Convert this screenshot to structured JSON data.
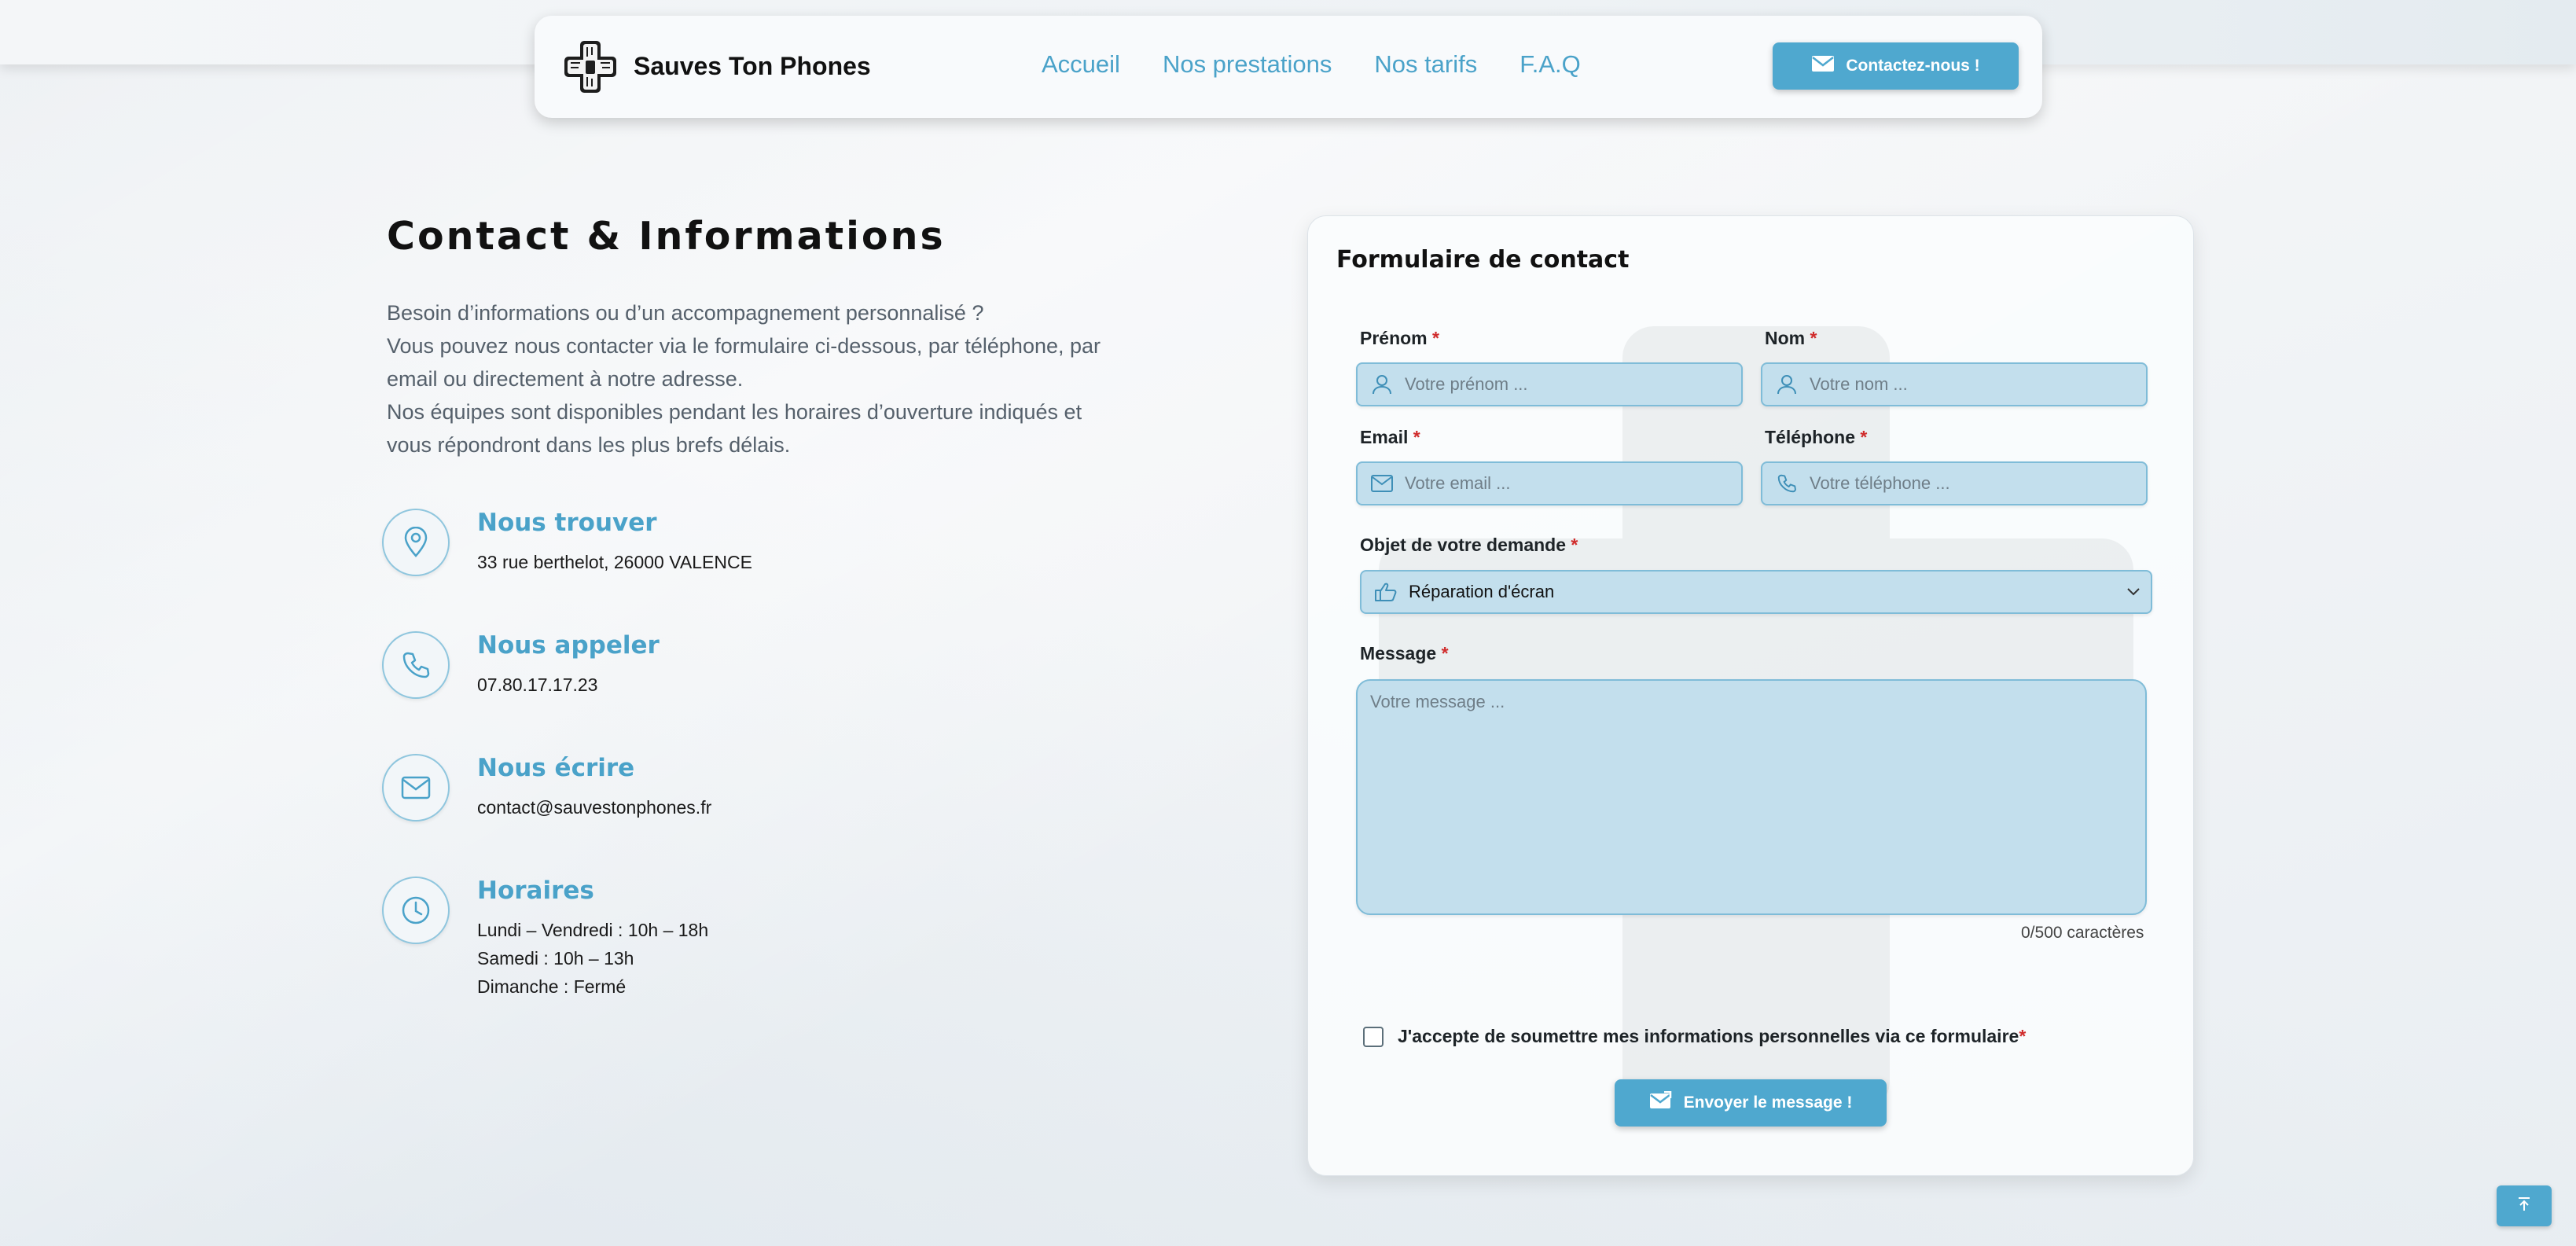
{
  "header": {
    "brand_name": "Sauves Ton Phones",
    "nav": [
      "Accueil",
      "Nos prestations",
      "Nos tarifs",
      "F.A.Q"
    ],
    "contact_button": "Contactez-nous !"
  },
  "page": {
    "title": "Contact & Informations",
    "intro": [
      "Besoin d’informations ou d’un accompagnement personnalisé ?",
      "Vous pouvez nous contacter via le formulaire ci-dessous, par téléphone, par email ou directement à notre adresse.",
      "Nos équipes sont disponibles pendant les horaires d’ouverture indiqués et vous répondront dans les plus brefs délais."
    ]
  },
  "info": [
    {
      "icon": "map-pin-icon",
      "title": "Nous trouver",
      "lines": [
        "33 rue berthelot, 26000 VALENCE"
      ]
    },
    {
      "icon": "phone-icon",
      "title": "Nous appeler",
      "lines": [
        "07.80.17.17.23"
      ]
    },
    {
      "icon": "mail-icon",
      "title": "Nous écrire",
      "lines": [
        "contact@sauvestonphones.fr"
      ]
    },
    {
      "icon": "clock-icon",
      "title": "Horaires",
      "lines": [
        "Lundi – Vendredi : 10h – 18h",
        "Samedi : 10h – 13h",
        "Dimanche : Fermé"
      ]
    }
  ],
  "form": {
    "title": "Formulaire de contact",
    "required_mark": "*",
    "firstname": {
      "label": "Prénom",
      "placeholder": "Votre prénom ..."
    },
    "lastname": {
      "label": "Nom",
      "placeholder": "Votre nom ..."
    },
    "email": {
      "label": "Email",
      "placeholder": "Votre email ..."
    },
    "phone": {
      "label": "Téléphone",
      "placeholder": "Votre téléphone ..."
    },
    "subject": {
      "label": "Objet de votre demande",
      "value": "Réparation d'écran"
    },
    "message": {
      "label": "Message",
      "placeholder": "Votre message ...",
      "counter": "0/500 caractères"
    },
    "consent": "J'accepte de soumettre mes informations personnelles via ce formulaire",
    "submit": "Envoyer le message !"
  },
  "colors": {
    "accent": "#4fa8cf",
    "required": "#d02c2c",
    "field_bg": "#c3dfed"
  }
}
